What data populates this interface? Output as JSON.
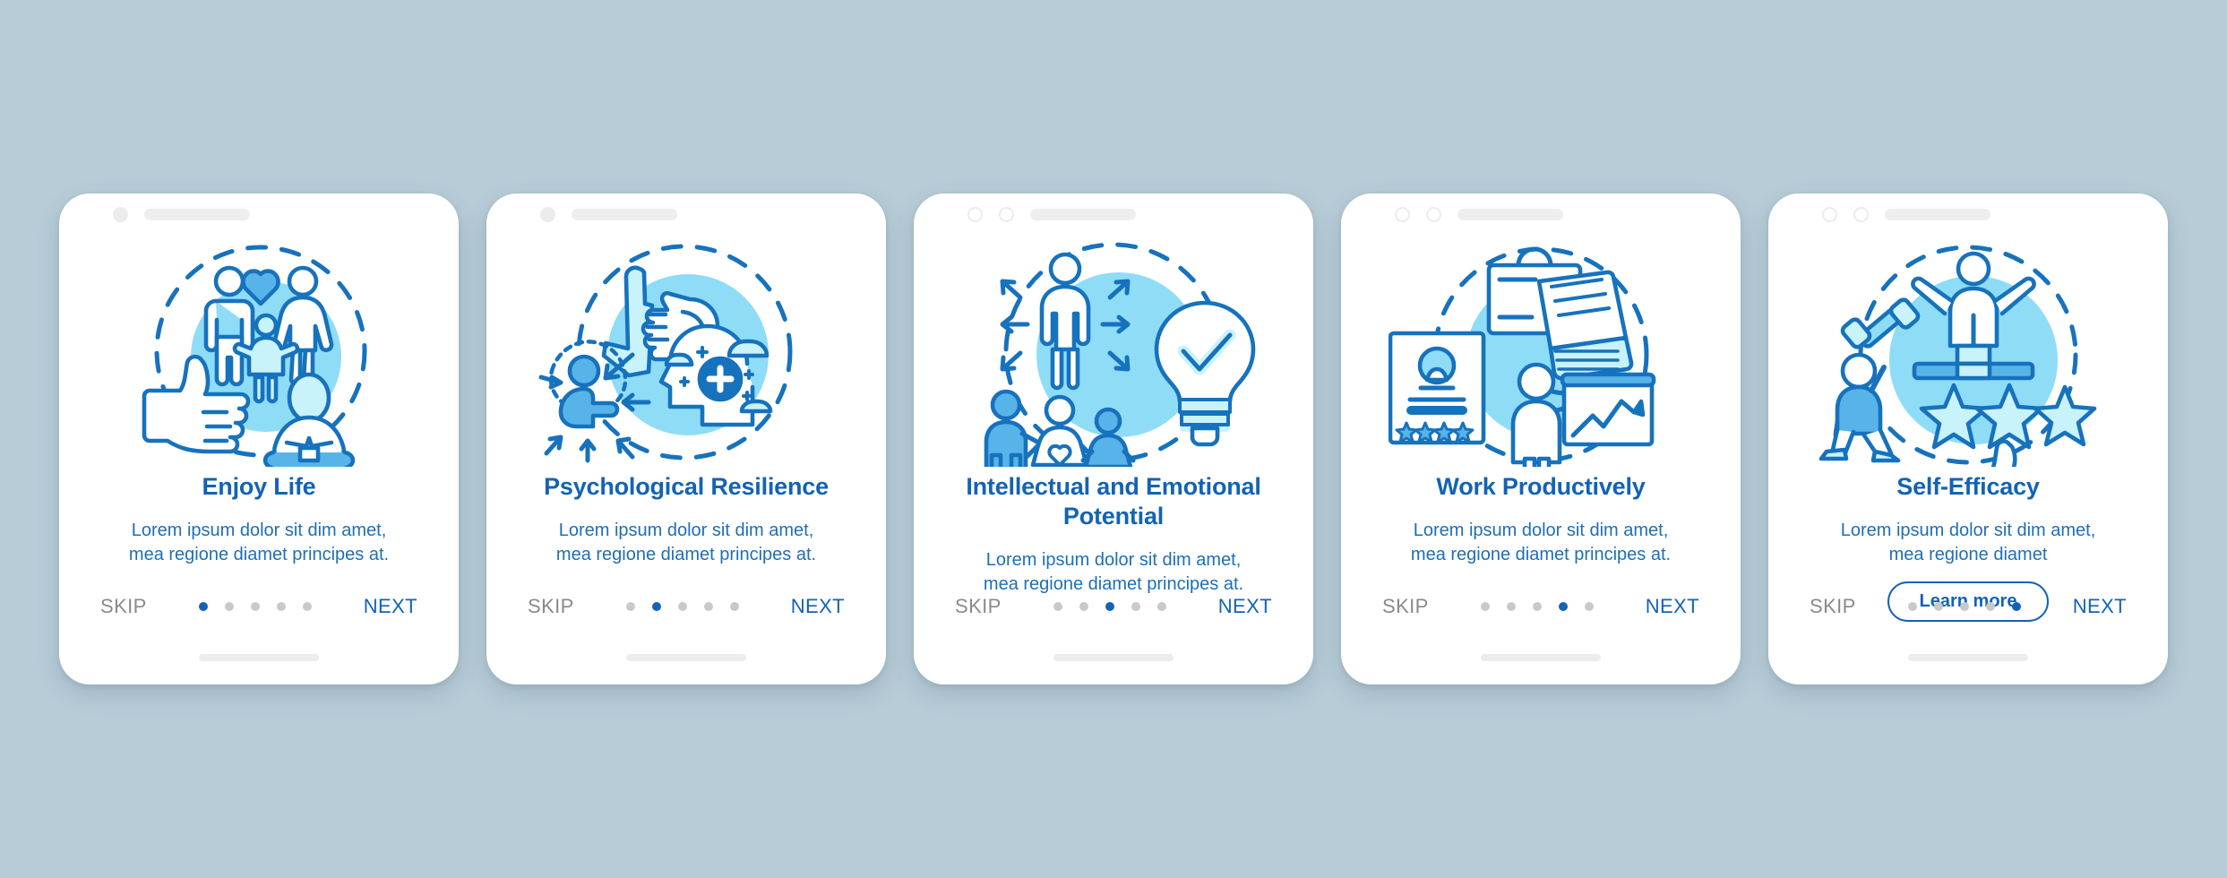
{
  "theme": {
    "background": "#b7ccd7",
    "card_background": "#ffffff",
    "accent": "#1363b4",
    "body_text": "#1d6fb8",
    "muted": "#8a8a8a",
    "dot_inactive": "#c9c9c9",
    "illustration_circle": "#8fdcf7",
    "illustration_stroke": "#1772bd",
    "illustration_fill_light": "#c9f3fb",
    "illustration_fill_mid": "#58b4e8"
  },
  "nav": {
    "skip_label": "SKIP",
    "next_label": "NEXT",
    "dot_count": 5
  },
  "cards": [
    {
      "title": "Enjoy Life",
      "body": "Lorem ipsum dolor sit dim amet, mea regione diamet principes at.",
      "active_dot": 1,
      "notch": "one-dot",
      "illustration": "family-heart-thumbsup-meditation",
      "cta": null
    },
    {
      "title": "Psychological Resilience",
      "body": "Lorem ipsum dolor sit dim amet, mea regione diamet principes at.",
      "active_dot": 2,
      "notch": "one-dot",
      "illustration": "hand-fist-head-plus-clouds",
      "cta": null
    },
    {
      "title": "Intellectual and Emotional Potential",
      "body": "Lorem ipsum dolor sit dim amet, mea regione diamet principes at.",
      "active_dot": 3,
      "notch": "two-rings",
      "illustration": "person-arrows-family-lightbulb-check",
      "cta": null
    },
    {
      "title": "Work Productively",
      "body": "Lorem ipsum dolor sit dim amet, mea regione diamet principes at.",
      "active_dot": 4,
      "notch": "two-rings",
      "illustration": "laptop-briefcase-certificate-stars-presenter-chart",
      "cta": null
    },
    {
      "title": "Self-Efficacy",
      "body": "Lorem ipsum dolor sit dim amet, mea regione diamet",
      "active_dot": 5,
      "notch": "two-rings",
      "illustration": "athlete-dumbbell-podium-stars-thumbsup",
      "cta": "Learn more"
    }
  ]
}
